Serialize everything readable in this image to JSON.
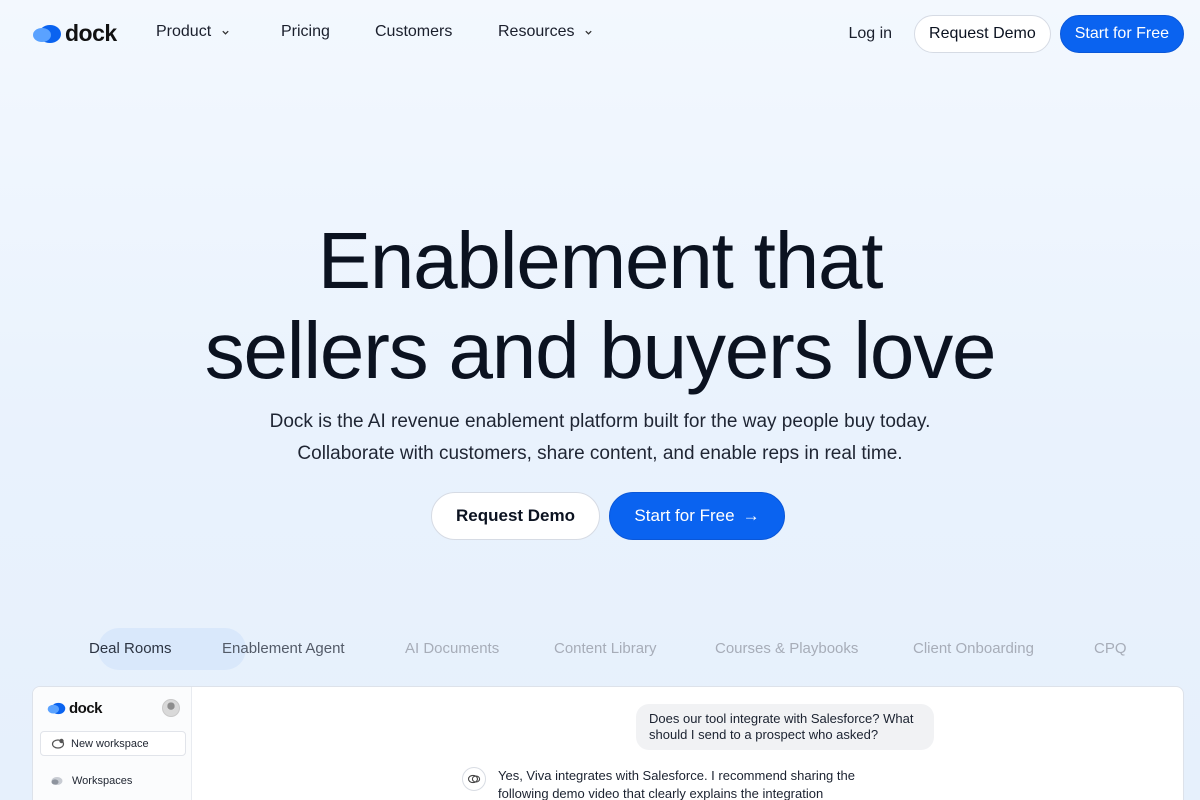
{
  "brand": {
    "name": "dock",
    "color": "#0a63f0"
  },
  "nav": {
    "links": [
      {
        "label": "Product",
        "has_dropdown": true
      },
      {
        "label": "Pricing",
        "has_dropdown": false
      },
      {
        "label": "Customers",
        "has_dropdown": false
      },
      {
        "label": "Resources",
        "has_dropdown": true
      }
    ],
    "login": "Log in",
    "request_demo": "Request Demo",
    "start_free": "Start for Free"
  },
  "hero": {
    "title_line1": "Enablement that",
    "title_line2": "sellers and buyers love",
    "subtitle_line1": "Dock is the AI revenue enablement platform built for the way people buy today.",
    "subtitle_line2": "Collaborate with customers, share content, and enable reps in real time.",
    "cta_demo": "Request Demo",
    "cta_free": "Start for Free",
    "cta_arrow": "→"
  },
  "tabs": {
    "active_index": 0,
    "items": [
      "Deal Rooms",
      "Enablement Agent",
      "AI Documents",
      "Content Library",
      "Courses & Playbooks",
      "Client Onboarding",
      "CPQ"
    ]
  },
  "preview": {
    "logo": "dock",
    "new_workspace": "New workspace",
    "workspaces": "Workspaces",
    "question": "Does our tool integrate with Salesforce? What should I send to a prospect who asked?",
    "answer": "Yes, Viva integrates with Salesforce. I recommend sharing the following demo video that clearly explains the integration"
  },
  "icons": {
    "logo": "dock-cloud-icon",
    "dropdown": "chevron-down-icon",
    "arrow": "arrow-right-icon",
    "new_workspace": "workspace-add-icon",
    "workspaces": "workspaces-icon",
    "assistant": "ai-assistant-icon"
  }
}
